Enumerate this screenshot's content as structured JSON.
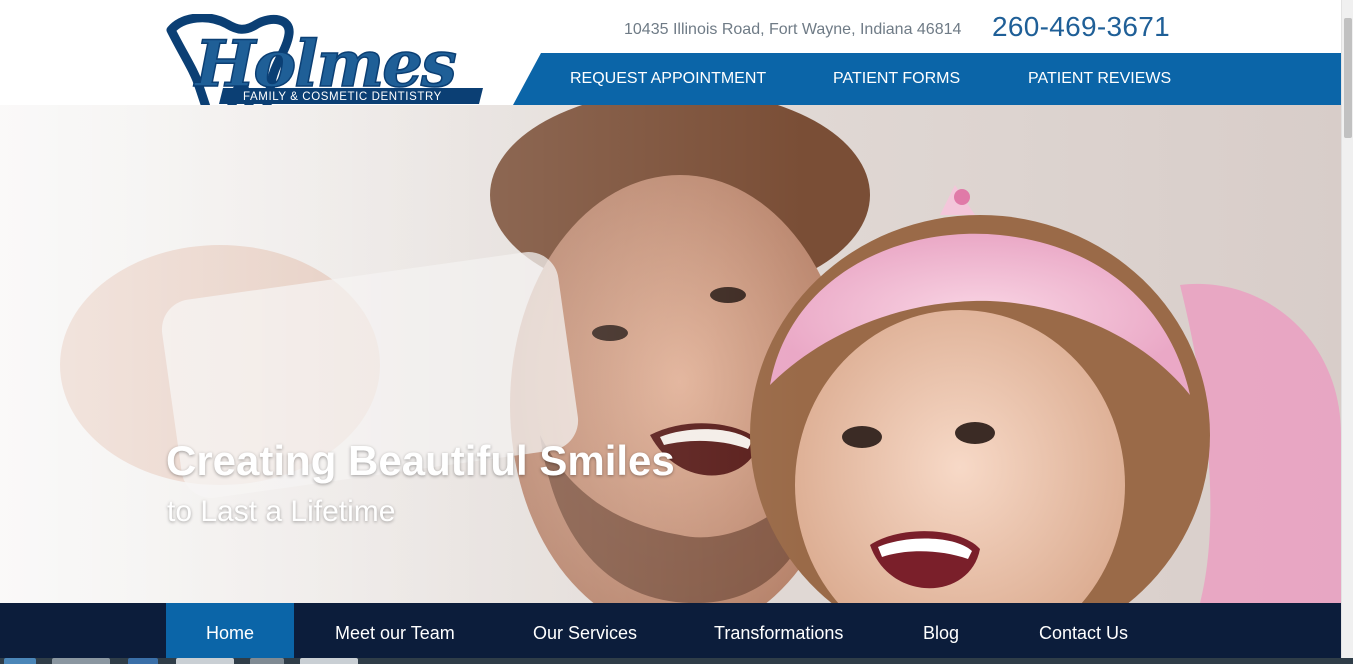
{
  "logo": {
    "name": "Holmes",
    "tagline": "FAMILY & COSMETIC DENTISTRY"
  },
  "header": {
    "address": "10435 Illinois Road, Fort Wayne, Indiana 46814",
    "phone": "260-469-3671"
  },
  "top_nav": {
    "items": [
      {
        "label": "REQUEST APPOINTMENT"
      },
      {
        "label": "PATIENT FORMS"
      },
      {
        "label": "PATIENT REVIEWS"
      }
    ]
  },
  "hero": {
    "title": "Creating Beautiful Smiles",
    "subtitle": "to Last a Lifetime"
  },
  "main_nav": {
    "active": "Home",
    "items": [
      {
        "label": "Home"
      },
      {
        "label": "Meet our Team"
      },
      {
        "label": "Our Services"
      },
      {
        "label": "Transformations"
      },
      {
        "label": "Blog"
      },
      {
        "label": "Contact Us"
      }
    ]
  },
  "colors": {
    "brand_blue": "#0b65a8",
    "navy": "#0c1d3b",
    "logo_blue": "#1f5f97"
  }
}
